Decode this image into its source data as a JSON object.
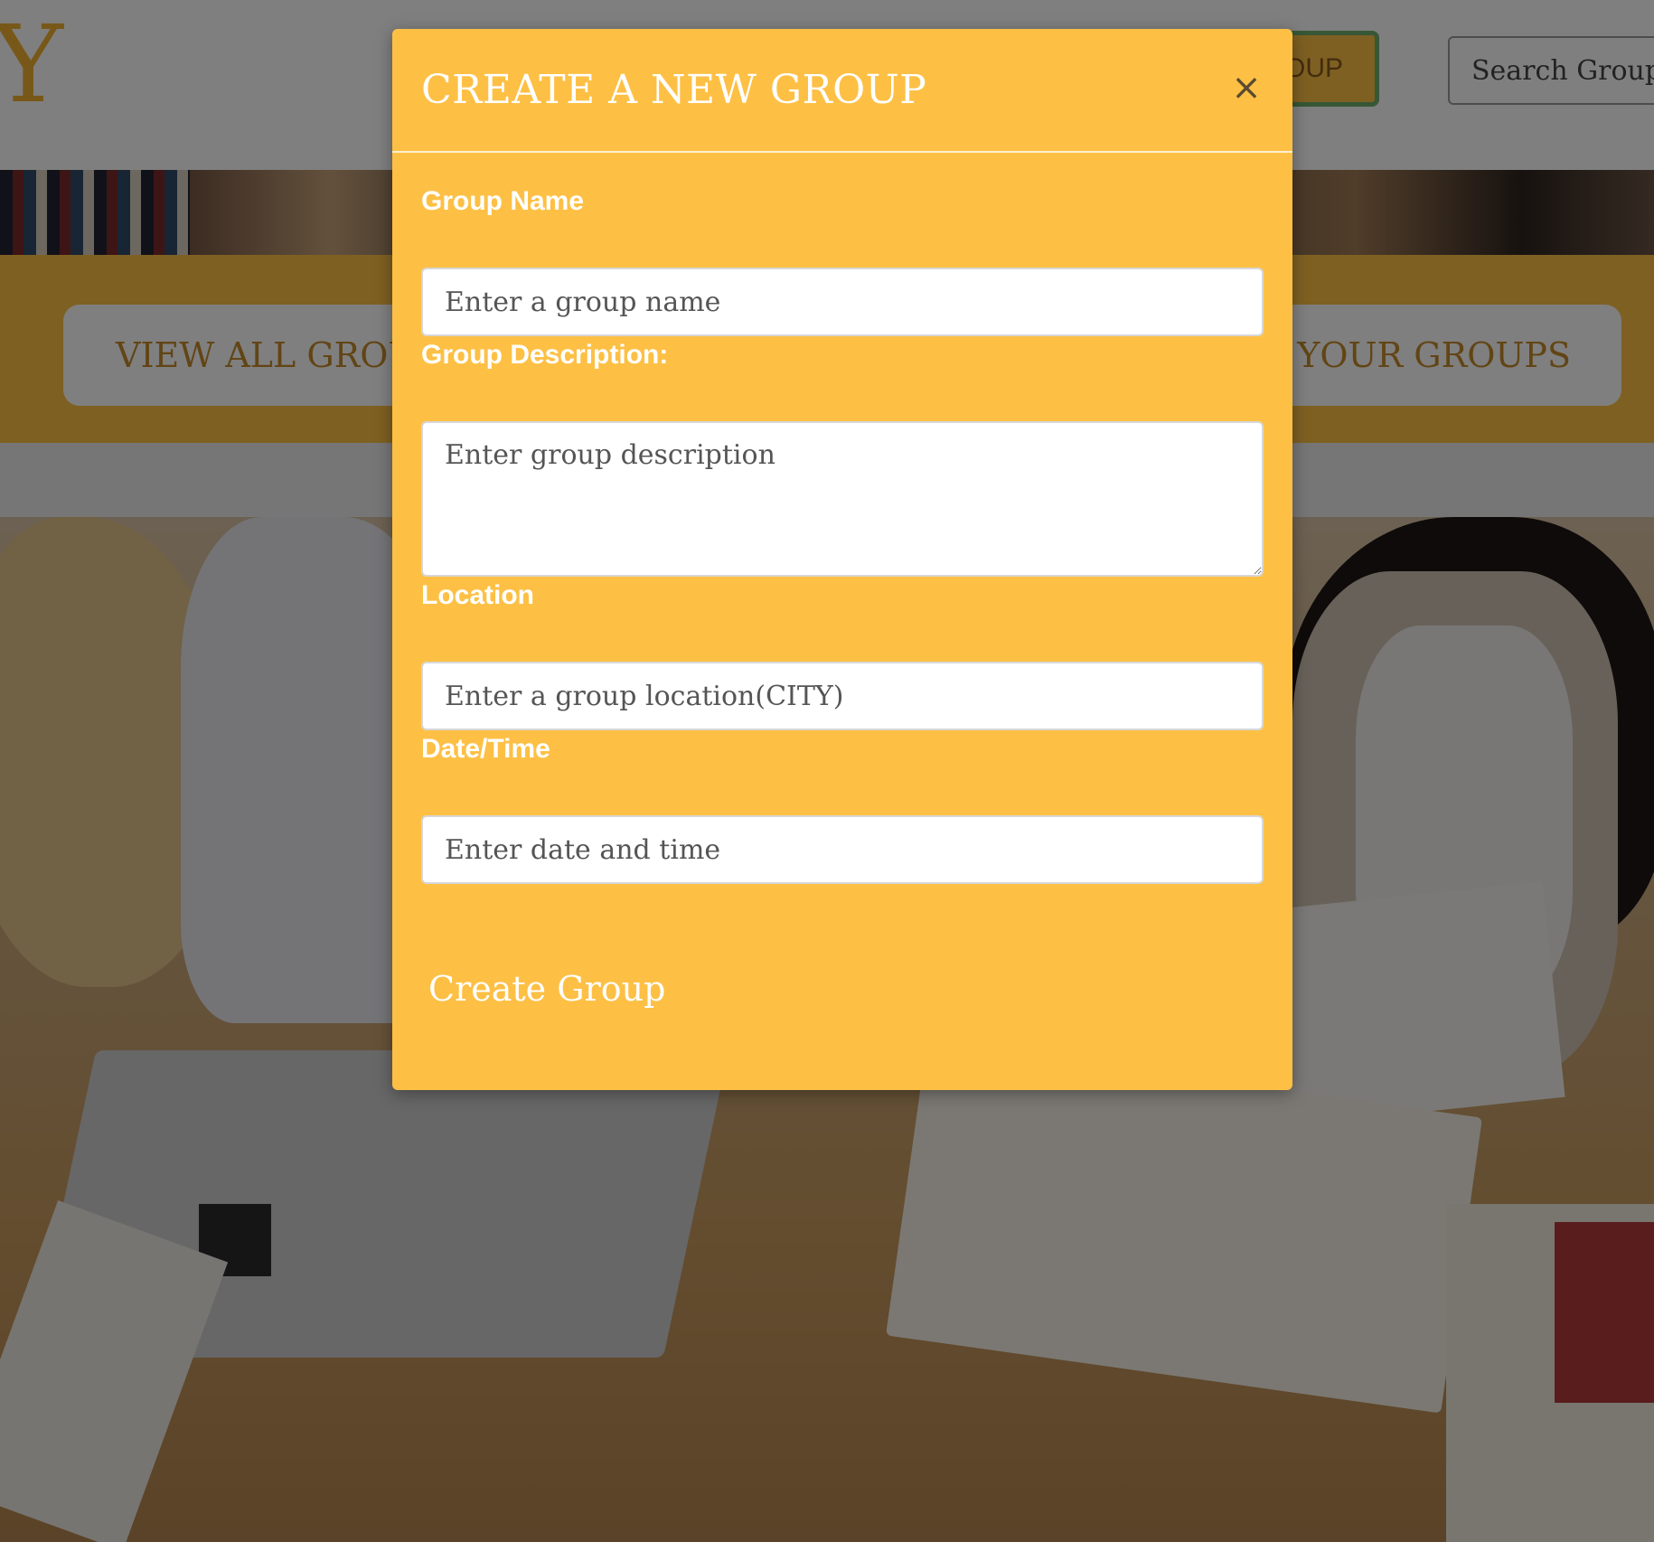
{
  "background": {
    "logo_text": "Y",
    "nav": {
      "create_group_label": "GROUP",
      "search_group_label": "Search Group"
    },
    "band": {
      "view_all_groups_label": "VIEW ALL GROUP",
      "view_your_groups_label": "W YOUR GROUPS"
    }
  },
  "modal": {
    "title": "CREATE A NEW GROUP",
    "close_label": "×",
    "fields": {
      "group_name": {
        "label": "Group Name",
        "placeholder": "Enter a group name",
        "value": ""
      },
      "group_description": {
        "label": "Group Description:",
        "placeholder": "Enter group description",
        "value": ""
      },
      "location": {
        "label": "Location",
        "placeholder": "Enter a group location(CITY)",
        "value": ""
      },
      "date_time": {
        "label": "Date/Time",
        "placeholder": "Enter date and time",
        "value": ""
      }
    },
    "submit_label": "Create Group"
  },
  "colors": {
    "modal_background": "#fdc045",
    "accent_text": "#c48a2a",
    "nav_button_border": "#6fae6f"
  }
}
